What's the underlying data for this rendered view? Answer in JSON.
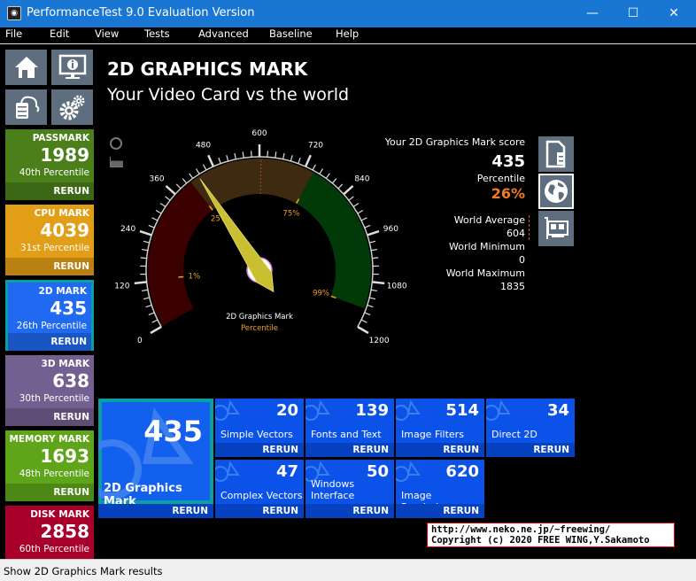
{
  "window": {
    "title": "PerformanceTest 9.0 Evaluation Version",
    "minimize": "—",
    "maximize": "☐",
    "close": "✕"
  },
  "menu": [
    "File",
    "Edit",
    "View",
    "Tests",
    "Advanced",
    "Baseline",
    "Help"
  ],
  "nav_icons": [
    "home-icon",
    "system-info-icon",
    "cloud-database-icon",
    "settings-gears-icon"
  ],
  "tiles": [
    {
      "name": "PASSMARK",
      "value": "1989",
      "percentile": "40th Percentile",
      "rerun": "RERUN",
      "color": "#4a7f1a"
    },
    {
      "name": "CPU MARK",
      "value": "4039",
      "percentile": "31st Percentile",
      "rerun": "RERUN",
      "color": "#e39e17"
    },
    {
      "name": "2D MARK",
      "value": "435",
      "percentile": "26th Percentile",
      "rerun": "RERUN",
      "color": "#1f6af0"
    },
    {
      "name": "3D MARK",
      "value": "638",
      "percentile": "30th Percentile",
      "rerun": "RERUN",
      "color": "#736090"
    },
    {
      "name": "MEMORY MARK",
      "value": "1693",
      "percentile": "48th Percentile",
      "rerun": "RERUN",
      "color": "#5ea51a"
    },
    {
      "name": "DISK MARK",
      "value": "2858",
      "percentile": "60th Percentile",
      "rerun": "RERUN",
      "color": "#a8002a"
    }
  ],
  "header": {
    "title": "2D GRAPHICS MARK",
    "subtitle": "Your Video Card vs the world"
  },
  "gauge": {
    "min": 0,
    "max": 1200,
    "ticks": [
      "0",
      "120",
      "240",
      "360",
      "480",
      "600",
      "720",
      "840",
      "960",
      "1080",
      "1200"
    ],
    "value": 435,
    "world_average": 604,
    "bands": [
      {
        "from": 0,
        "to": 410,
        "color": "#3a0000"
      },
      {
        "from": 410,
        "to": 745,
        "color": "#3d2a10"
      },
      {
        "from": 745,
        "to": 1150,
        "color": "#013a08"
      }
    ],
    "markers": [
      {
        "label": "1%",
        "value": 125
      },
      {
        "label": "25%",
        "value": 410
      },
      {
        "label": "75%",
        "value": 745
      },
      {
        "label": "99%",
        "value": 1150
      }
    ],
    "center_label": "2D Graphics Mark",
    "center_sub": "Percentile"
  },
  "score": {
    "label": "Your 2D Graphics Mark score",
    "value": "435",
    "percentile_label": "Percentile",
    "percentile": "26%",
    "avg_label": "World Average",
    "avg": "604",
    "min_label": "World Minimum",
    "min": "0",
    "max_label": "World Maximum",
    "max": "1835",
    "accent": "#f47a20"
  },
  "main_tile": {
    "value": "435",
    "label": "2D Graphics Mark",
    "rerun": "RERUN"
  },
  "subtests": [
    {
      "value": "20",
      "label": "Simple Vectors",
      "rerun": "RERUN"
    },
    {
      "value": "139",
      "label": "Fonts and Text",
      "rerun": "RERUN"
    },
    {
      "value": "514",
      "label": "Image Filters",
      "rerun": "RERUN"
    },
    {
      "value": "34",
      "label": "Direct 2D",
      "rerun": "RERUN"
    },
    {
      "value": "47",
      "label": "Complex Vectors",
      "rerun": "RERUN"
    },
    {
      "value": "50",
      "label": "Windows Interface",
      "rerun": "RERUN"
    },
    {
      "value": "620",
      "label": "Image Rendering",
      "rerun": "RERUN"
    }
  ],
  "copyright": {
    "line1": "http://www.neko.ne.jp/~freewing/",
    "line2": "Copyright (c) 2020 FREE WING,Y.Sakamoto"
  },
  "status": "Show 2D Graphics Mark results"
}
